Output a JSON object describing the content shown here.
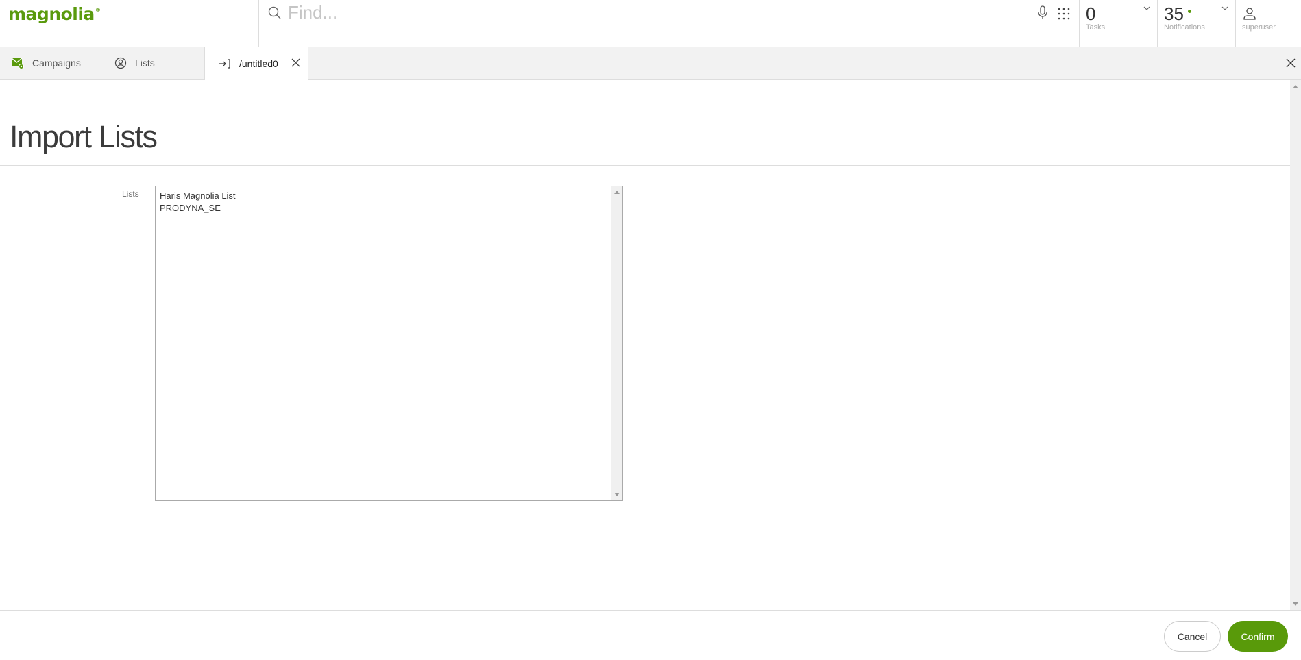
{
  "header": {
    "logo": "magnolia",
    "search": {
      "placeholder": "Find...",
      "value": ""
    },
    "tasks": {
      "count": "0",
      "label": "Tasks"
    },
    "notifications": {
      "count": "35",
      "label": "Notifications",
      "dot_color": "#5a9a0d"
    },
    "user": {
      "name": "superuser"
    }
  },
  "tabs": [
    {
      "label": "Campaigns",
      "icon": "mail-gear-icon",
      "active": false
    },
    {
      "label": "Lists",
      "icon": "user-circle-icon",
      "active": false
    },
    {
      "label": "/untitled0",
      "icon": "import-arrow-icon",
      "active": true,
      "closable": true
    }
  ],
  "page": {
    "title": "Import Lists",
    "field": {
      "label": "Lists",
      "options": [
        "Haris Magnolia List",
        "PRODYNA_SE"
      ]
    }
  },
  "footer": {
    "cancel_label": "Cancel",
    "confirm_label": "Confirm"
  },
  "colors": {
    "brand": "#5a9a0d",
    "confirm": "#599a0a"
  }
}
